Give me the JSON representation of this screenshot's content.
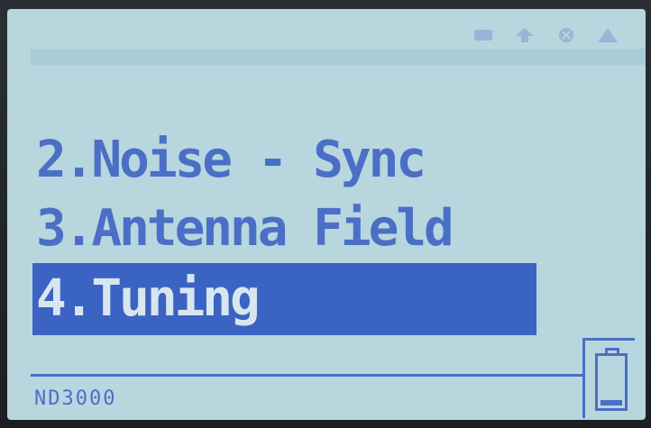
{
  "menu": {
    "items": [
      {
        "label": "2.Noise - Sync"
      },
      {
        "label": "3.Antenna Field"
      },
      {
        "label": "4.Tuning",
        "selected": true
      }
    ]
  },
  "footer": {
    "device_label": "ND3000"
  },
  "battery": {
    "level_fraction": 0.1
  },
  "status_icons": [
    "device-icon",
    "up-arrow-icon",
    "close-circle-icon",
    "warning-triangle-icon"
  ],
  "colors": {
    "screen_bg": "#b8d6de",
    "text": "#4b6fc6",
    "selection_bg": "#3a63c4",
    "selection_text": "#d8e6f0"
  }
}
